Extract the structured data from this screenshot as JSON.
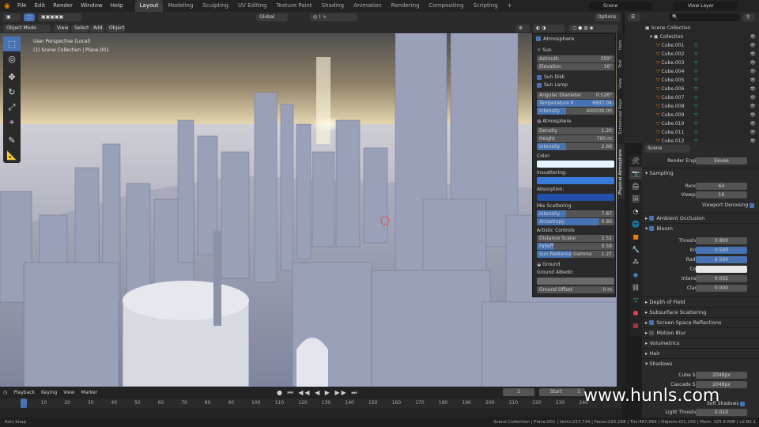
{
  "app": {
    "menu": [
      "File",
      "Edit",
      "Render",
      "Window",
      "Help"
    ],
    "workspaces": [
      "Layout",
      "Modeling",
      "Sculpting",
      "UV Editing",
      "Texture Paint",
      "Shading",
      "Animation",
      "Rendering",
      "Compositing",
      "Scripting"
    ],
    "active_workspace": "Layout",
    "add_ws": "+",
    "scene": "Scene",
    "view_layer": "View Layer"
  },
  "viewport_header": {
    "mode": "Object Mode",
    "view": "View",
    "select": "Select",
    "add": "Add",
    "object": "Object",
    "transform": "Global",
    "options": "Options"
  },
  "viewport": {
    "perspective": "User Perspective (Local)",
    "collection": "(1) Scene Collection | Plane.001"
  },
  "atmosphere": {
    "title": "Atmosphere",
    "sun_label": "Sun",
    "azimuth_label": "Azimuth",
    "azimuth": "359°",
    "elevation_label": "Elevation",
    "elevation": "16°",
    "sun_disk": "Sun Disk",
    "sun_lamp": "Sun Lamp",
    "angular_label": "Angular Diameter",
    "angular": "0.526°",
    "temp_label": "Temperature K",
    "temp": "6897.04",
    "intensity_label": "Intensity",
    "intensity": "400000.00",
    "atmo_section": "Atmosphere",
    "density_label": "Density",
    "density": "1.20",
    "height_label": "Height",
    "height": "700 m",
    "atmo_int_label": "Intensity",
    "atmo_int": "2.69",
    "color_label": "Color:",
    "inscattering_label": "Inscattering:",
    "absorption_label": "Absorption:",
    "mie_label": "Mie Scattering",
    "mie_int_label": "Intensity",
    "mie_int": "7.87",
    "aniso_label": "Anisotropy",
    "aniso": "0.80",
    "artistic_label": "Artistic Controls",
    "dist_label": "Distance Scalar",
    "dist": "2.51",
    "falloff_label": "Falloff",
    "falloff": "0.59",
    "gamma_label": "Sun Radiance Gamma",
    "gamma": "1.27",
    "ground_label": "Ground",
    "albedo_label": "Ground Albedo:",
    "offset_label": "Ground Offset",
    "offset": "0 m"
  },
  "side_tabs": [
    "Item",
    "Tool",
    "View",
    "Screencast Keys",
    "Physical Atmosphere"
  ],
  "outliner": {
    "search": "",
    "root": "Scene Collection",
    "collection": "Collection",
    "items": [
      "Cube.001",
      "Cube.002",
      "Cube.003",
      "Cube.004",
      "Cube.005",
      "Cube.006",
      "Cube.007",
      "Cube.008",
      "Cube.009",
      "Cube.010",
      "Cube.011",
      "Cube.012"
    ]
  },
  "properties": {
    "scene": "Scene",
    "engine_label": "Render Engine",
    "engine": "Eevee",
    "sampling": "Sampling",
    "render_label": "Render",
    "render": "64",
    "viewport_label": "Viewport",
    "viewport": "16",
    "denoise": "Viewport Denoising",
    "ao": "Ambient Occlusion",
    "bloom": "Bloom",
    "threshold_label": "Threshold",
    "threshold": "0.800",
    "knee_label": "Knee",
    "knee": "0.500",
    "radius_label": "Radius",
    "radius": "6.500",
    "color_label": "Color",
    "bintensity_label": "Intensity",
    "bintensity": "0.002",
    "clamp_label": "Clamp",
    "clamp": "0.000",
    "dof": "Depth of Field",
    "sss": "Subsurface Scattering",
    "ssr": "Screen Space Reflections",
    "motion": "Motion Blur",
    "volumetrics": "Volumetrics",
    "hair": "Hair",
    "shadows": "Shadows",
    "cube_label": "Cube Size",
    "cube": "2048px",
    "cascade_label": "Cascade Size",
    "cascade": "2048px",
    "soft": "Soft Shadows",
    "light_label": "Light Threshold",
    "light": "0.010"
  },
  "timeline": {
    "playback": "Playback",
    "keying": "Keying",
    "view": "View",
    "marker": "Marker",
    "current": "1",
    "start_label": "Start",
    "start": "1",
    "frames": [
      "1",
      "10",
      "20",
      "30",
      "40",
      "50",
      "60",
      "70",
      "80",
      "90",
      "100",
      "110",
      "120",
      "130",
      "140",
      "150",
      "160",
      "170",
      "180",
      "190",
      "200",
      "210",
      "220",
      "230",
      "240"
    ]
  },
  "status": {
    "left": "Axis Snap",
    "right": "Scene Collection | Plane.001 | Verts:237,734 | Faces:225,168 | Tris:467,064 | Objects:0/1,156 | Mem: 325.6 MiB | v2.82.1"
  },
  "watermark": "www.hunls.com",
  "colors": {
    "accent": "#4772b3",
    "color_swatch": "#e6f4ff",
    "inscatter": "#3a7ad9",
    "absorption": "#2350a8"
  }
}
